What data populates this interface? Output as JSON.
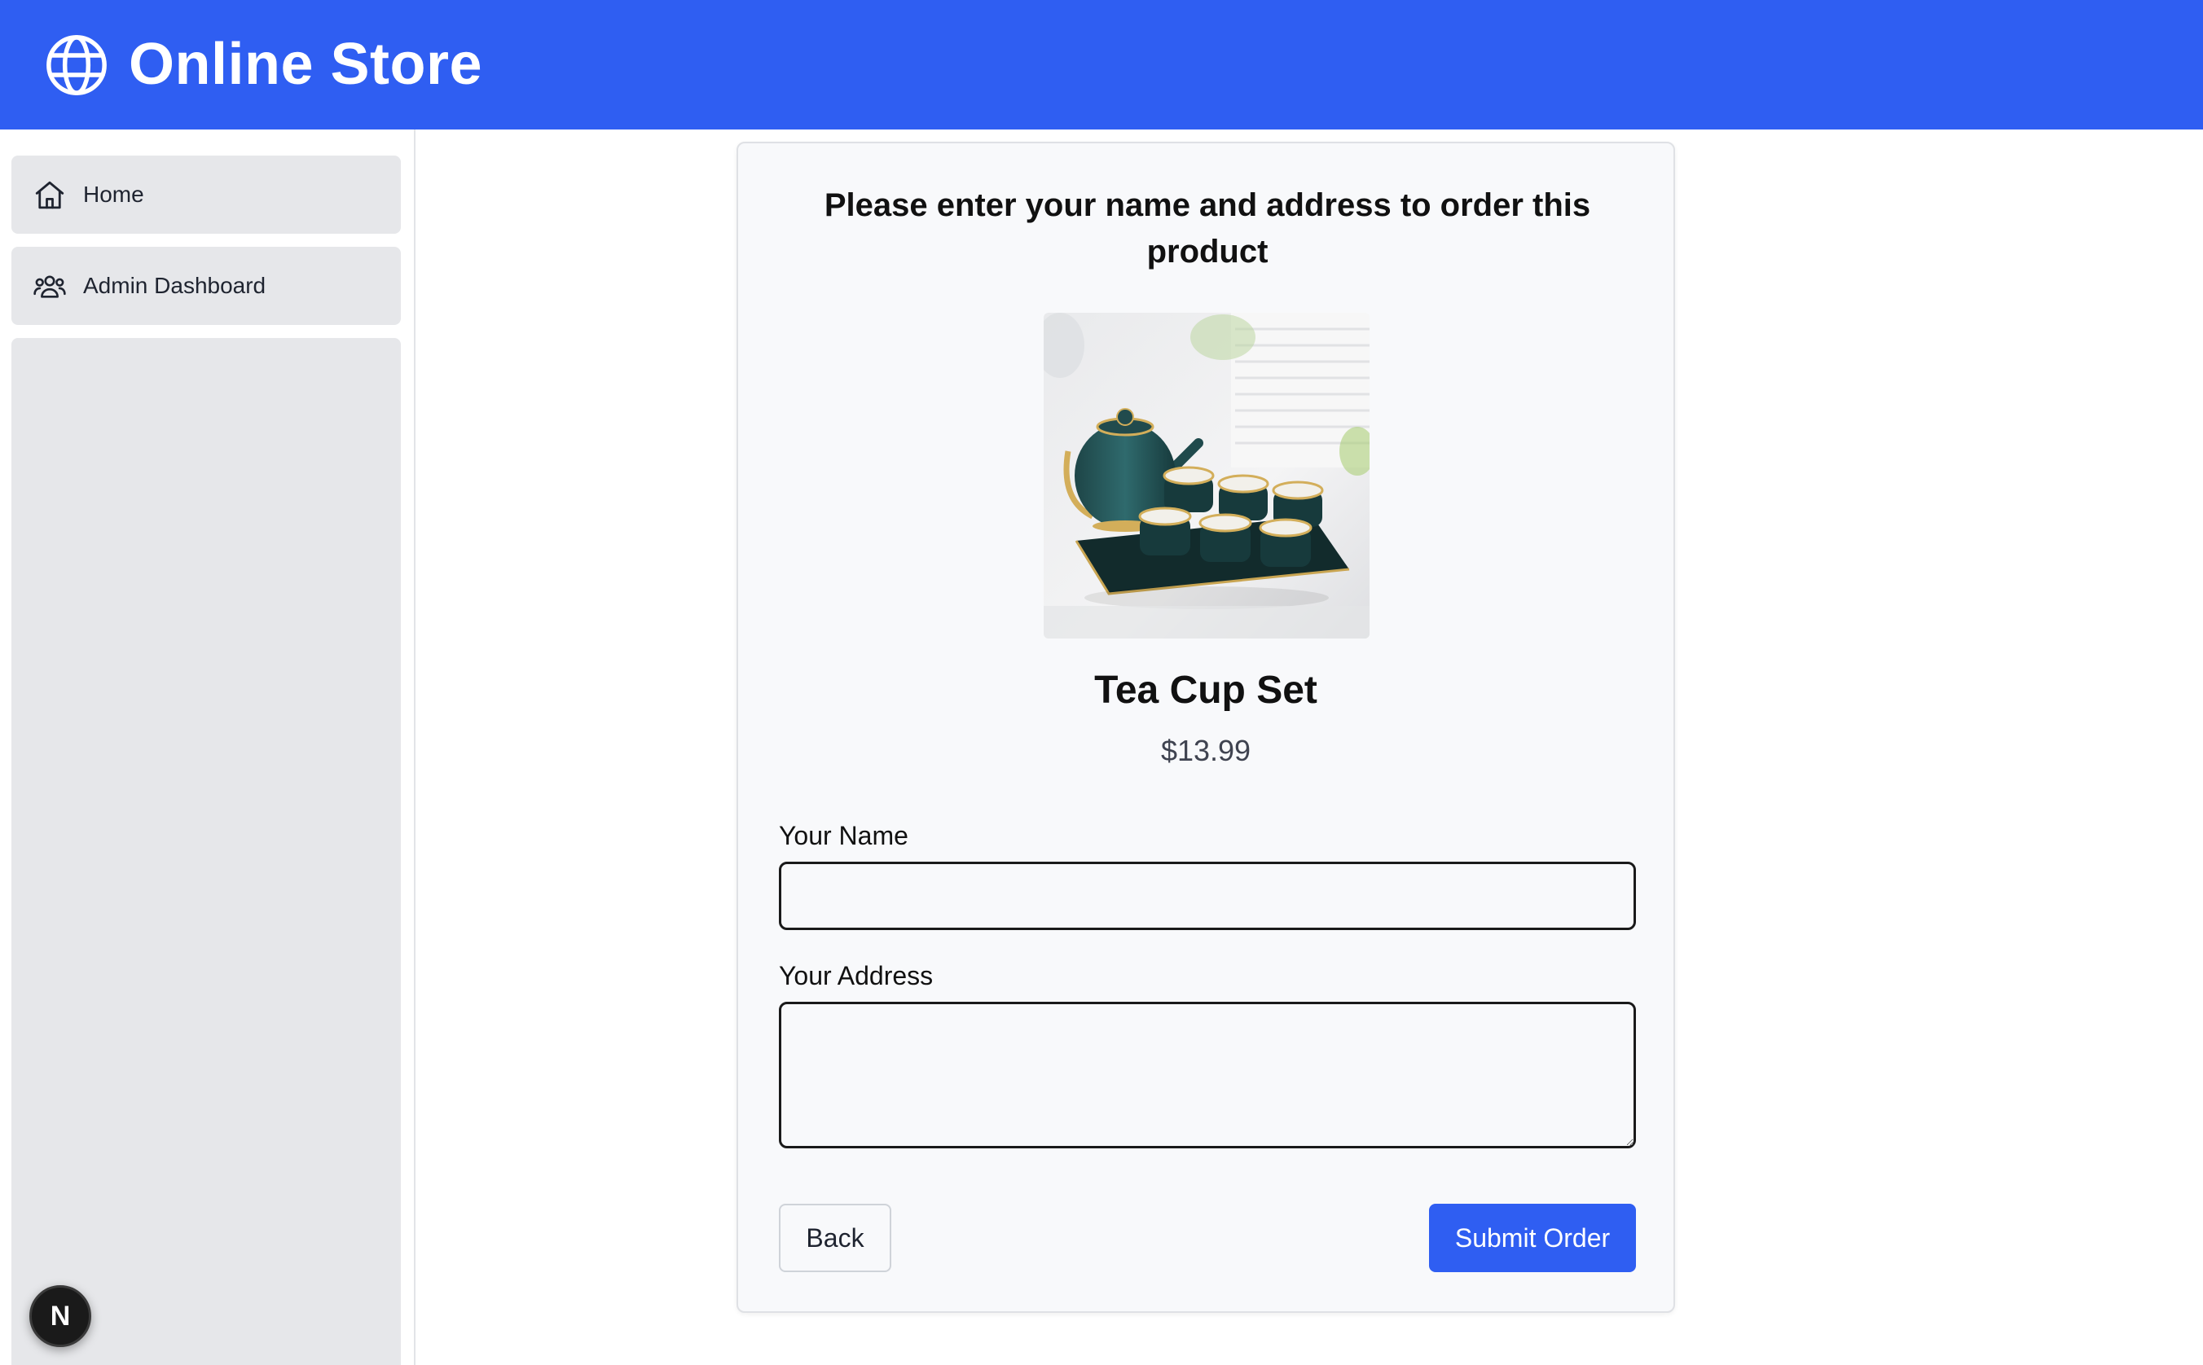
{
  "app": {
    "title": "Online Store",
    "brand_icon": "globe-icon",
    "accent_color": "#2f5ef2"
  },
  "sidebar": {
    "items": [
      {
        "label": "Home",
        "icon": "home-icon"
      },
      {
        "label": "Admin Dashboard",
        "icon": "users-icon"
      }
    ]
  },
  "order_form": {
    "heading": "Please enter your name and address to order this product",
    "product": {
      "name": "Tea Cup Set",
      "price": "$13.99",
      "image": "tea-cup-set-photo"
    },
    "name_label": "Your Name",
    "name_value": "",
    "address_label": "Your Address",
    "address_value": "",
    "back_label": "Back",
    "submit_label": "Submit Order"
  },
  "dev_badge": {
    "label": "N"
  }
}
